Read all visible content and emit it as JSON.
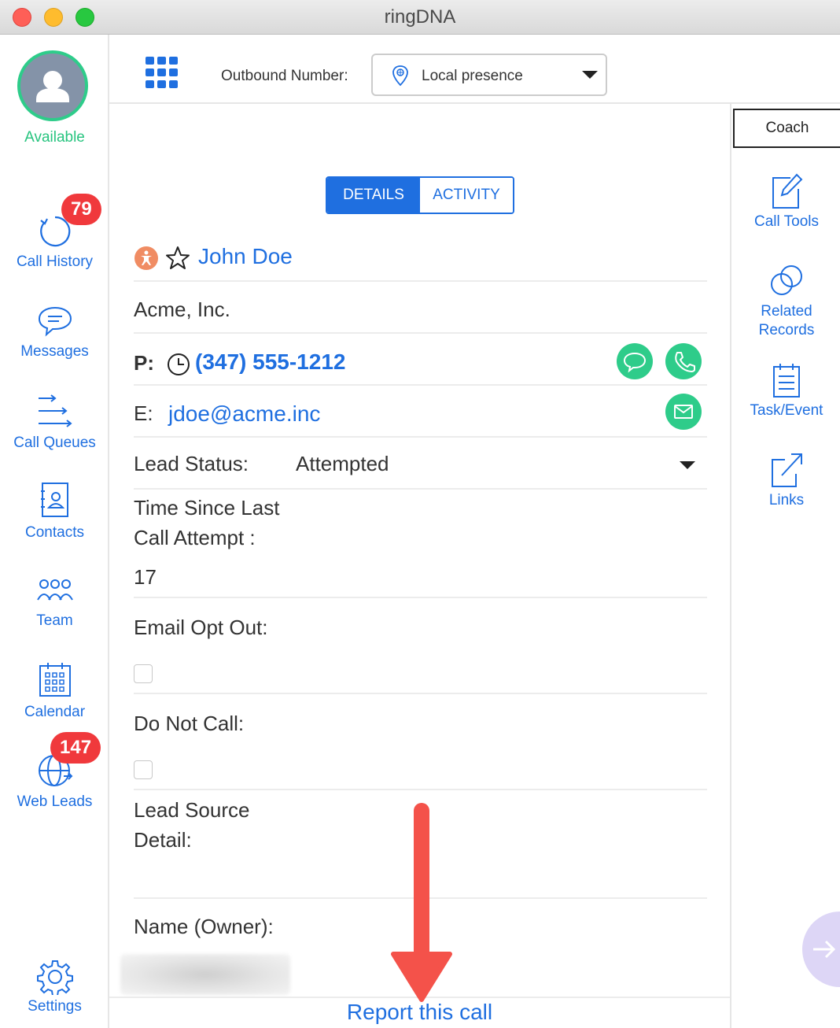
{
  "window": {
    "title": "ringDNA"
  },
  "user": {
    "status": "Available"
  },
  "sidebar": {
    "items": [
      {
        "label": "Call History",
        "badge": "79"
      },
      {
        "label": "Messages"
      },
      {
        "label": "Call Queues"
      },
      {
        "label": "Contacts"
      },
      {
        "label": "Team"
      },
      {
        "label": "Calendar"
      },
      {
        "label": "Web Leads",
        "badge": "147"
      },
      {
        "label": "Settings"
      }
    ]
  },
  "header": {
    "outbound_label": "Outbound Number:",
    "outbound_value": "Local presence"
  },
  "tabs": [
    {
      "label": "DETAILS",
      "active": true
    },
    {
      "label": "ACTIVITY",
      "active": false
    }
  ],
  "contact": {
    "name": "John Doe",
    "company": "Acme, Inc.",
    "phone_label": "P:",
    "phone": "(347) 555-1212",
    "email_label": "E:",
    "email": "jdoe@acme.inc",
    "lead_status_label": "Lead Status:",
    "lead_status": "Attempted",
    "time_since_label": "Time Since Last Call Attempt :",
    "time_since_value": "17",
    "email_opt_out_label": "Email Opt Out:",
    "email_opt_out": false,
    "do_not_call_label": "Do Not Call:",
    "do_not_call": false,
    "lead_source_label": "Lead Source Detail:",
    "owner_label": "Name (Owner):"
  },
  "rail": {
    "coach": "Coach",
    "items": [
      {
        "label": "Call Tools"
      },
      {
        "label": "Related Records"
      },
      {
        "label": "Task/Event"
      },
      {
        "label": "Links"
      }
    ]
  },
  "footer": {
    "report_link": "Report this call"
  },
  "colors": {
    "accent": "#1f6fe0",
    "available": "#27c47f",
    "badge": "#f0393c",
    "action_green": "#2ecc8a",
    "annotation_arrow": "#f4524a"
  }
}
